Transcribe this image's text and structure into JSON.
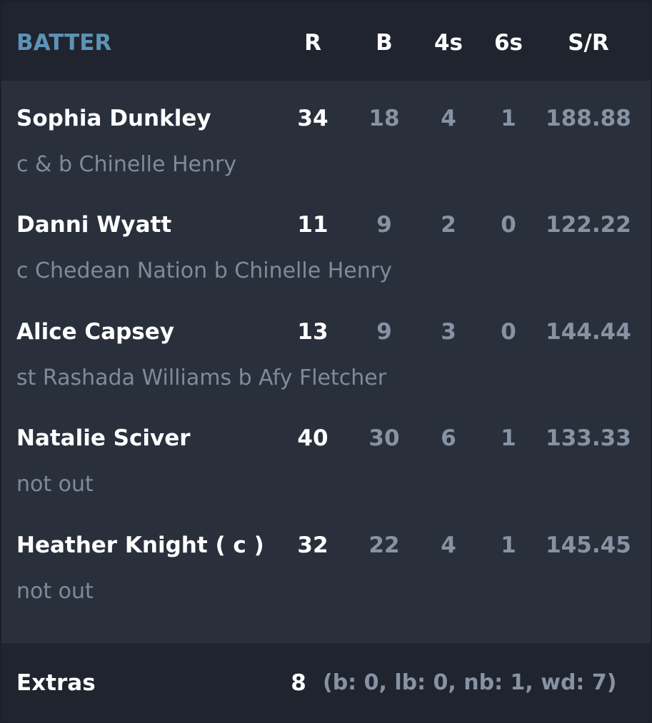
{
  "header": {
    "title": "BATTER",
    "columns": [
      "R",
      "B",
      "4s",
      "6s",
      "S/R"
    ]
  },
  "batters": [
    {
      "name": "Sophia Dunkley",
      "dismissal": "c & b Chinelle Henry",
      "runs": "34",
      "balls": "18",
      "fours": "4",
      "sixes": "1",
      "sr": "188.88"
    },
    {
      "name": "Danni Wyatt",
      "dismissal": "c Chedean Nation b Chinelle Henry",
      "runs": "11",
      "balls": "9",
      "fours": "2",
      "sixes": "0",
      "sr": "122.22"
    },
    {
      "name": "Alice Capsey",
      "dismissal": "st Rashada Williams b Afy Fletcher",
      "runs": "13",
      "balls": "9",
      "fours": "3",
      "sixes": "0",
      "sr": "144.44"
    },
    {
      "name": "Natalie Sciver",
      "dismissal": "not out",
      "runs": "40",
      "balls": "30",
      "fours": "6",
      "sixes": "1",
      "sr": "133.33"
    },
    {
      "name": "Heather Knight ( c )",
      "dismissal": "not out",
      "runs": "32",
      "balls": "22",
      "fours": "4",
      "sixes": "1",
      "sr": "145.45"
    }
  ],
  "extras": {
    "label": "Extras",
    "total": "8",
    "detail": "(b: 0, lb: 0, nb: 1, wd: 7)"
  },
  "colors": {
    "page_bg": "#1b202a",
    "card_bg": "#29303c",
    "header_bg": "#1f242e",
    "accent": "#5d93b6",
    "muted_text": "#8792a3"
  }
}
